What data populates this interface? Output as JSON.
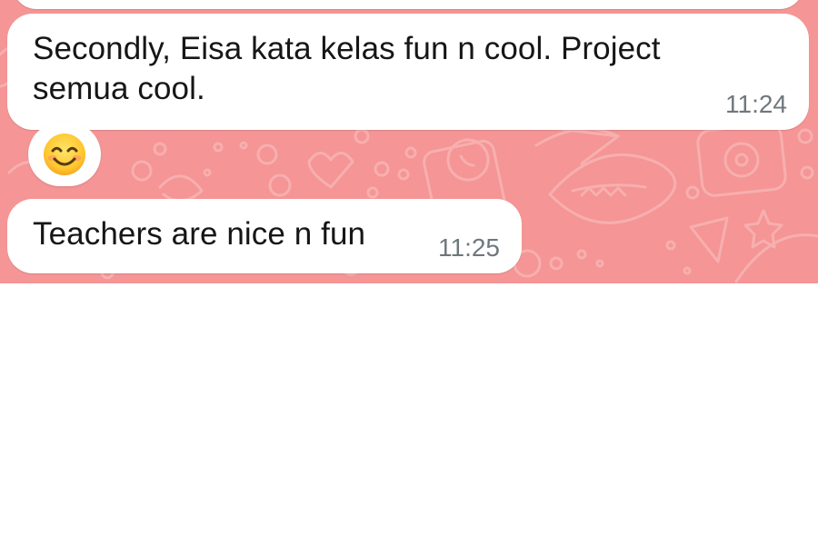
{
  "chat": {
    "background_color": "#f59595",
    "messages": [
      {
        "text": "Secondly, Eisa kata kelas fun n cool. Project semua cool.",
        "time": "11:24"
      },
      {
        "text": "Teachers are nice n fun",
        "time": "11:25"
      }
    ],
    "reaction": {
      "emoji": "smiling-face-with-smiling-eyes"
    }
  }
}
